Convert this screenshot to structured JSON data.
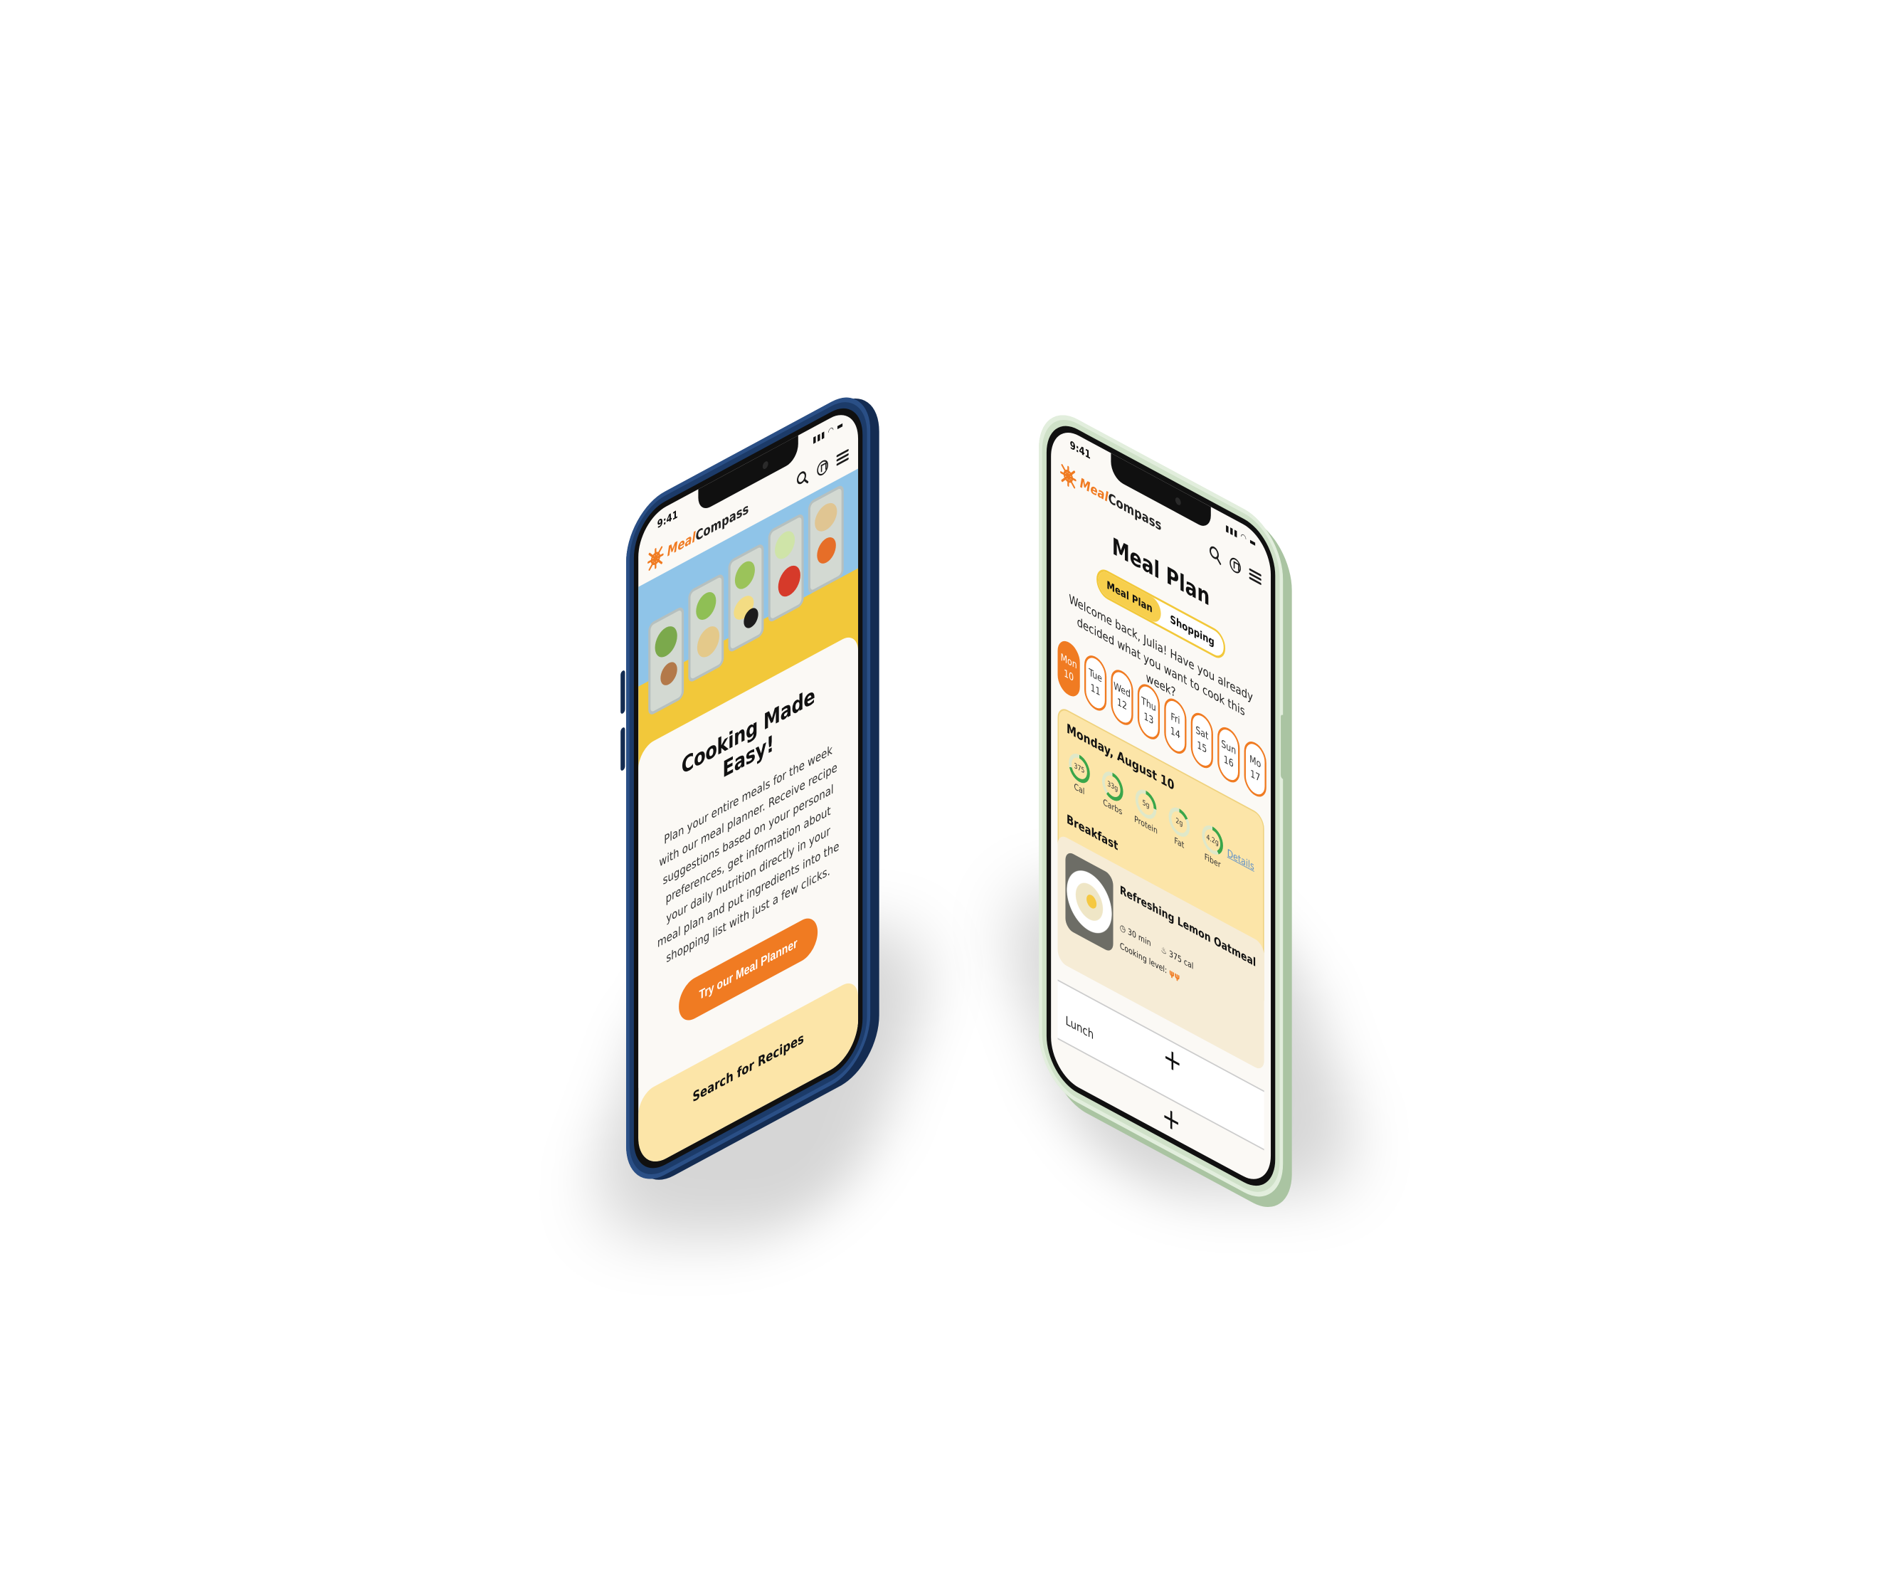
{
  "colors": {
    "accent": "#f07b22",
    "yellow": "#f7cf4d",
    "cream": "#fce5a8",
    "ring": "#3aa64a"
  },
  "phone_home": {
    "time": "9:41",
    "brand": {
      "part1": "Meal",
      "part2": "Compass"
    },
    "icons": [
      "search-icon",
      "bookmark-icon",
      "menu-icon"
    ],
    "headline": "Cooking Made Easy!",
    "body": "Plan your entire meals for the week with our meal planner. Receive recipe suggestions based on your personal preferences, get information about your daily nutrition directly in your meal plan and put ingredients into the shopping list with just a few clicks.",
    "cta": "Try our Meal Planner",
    "section2": "Search for Recipes"
  },
  "phone_plan": {
    "time": "9:41",
    "brand": {
      "part1": "Meal",
      "part2": "Compass"
    },
    "title": "Meal Plan",
    "tabs": [
      "Meal Plan",
      "Shopping"
    ],
    "welcome": "Welcome back, Julia! Have you already decided what you want to cook this week?",
    "days": [
      {
        "d": "Mon",
        "n": "10"
      },
      {
        "d": "Tue",
        "n": "11"
      },
      {
        "d": "Wed",
        "n": "12"
      },
      {
        "d": "Thu",
        "n": "13"
      },
      {
        "d": "Fri",
        "n": "14"
      },
      {
        "d": "Sat",
        "n": "15"
      },
      {
        "d": "Sun",
        "n": "16"
      },
      {
        "d": "Mo",
        "n": "17"
      }
    ],
    "date": "Monday, August 10",
    "details": "Details",
    "nutrition": [
      {
        "v": "375",
        "l": "Cal",
        "p": 70
      },
      {
        "v": "33g",
        "l": "Carbs",
        "p": 60
      },
      {
        "v": "5g",
        "l": "Protein",
        "p": 25
      },
      {
        "v": "2g",
        "l": "Fat",
        "p": 15
      },
      {
        "v": "4.2g",
        "l": "Fiber",
        "p": 40
      }
    ],
    "breakfast": "Breakfast",
    "recipe": {
      "title": "Refreshing Lemon Oatmeal",
      "time": "30 min",
      "cal": "375 cal",
      "level": "Cooking level:"
    },
    "lunch": "Lunch"
  }
}
